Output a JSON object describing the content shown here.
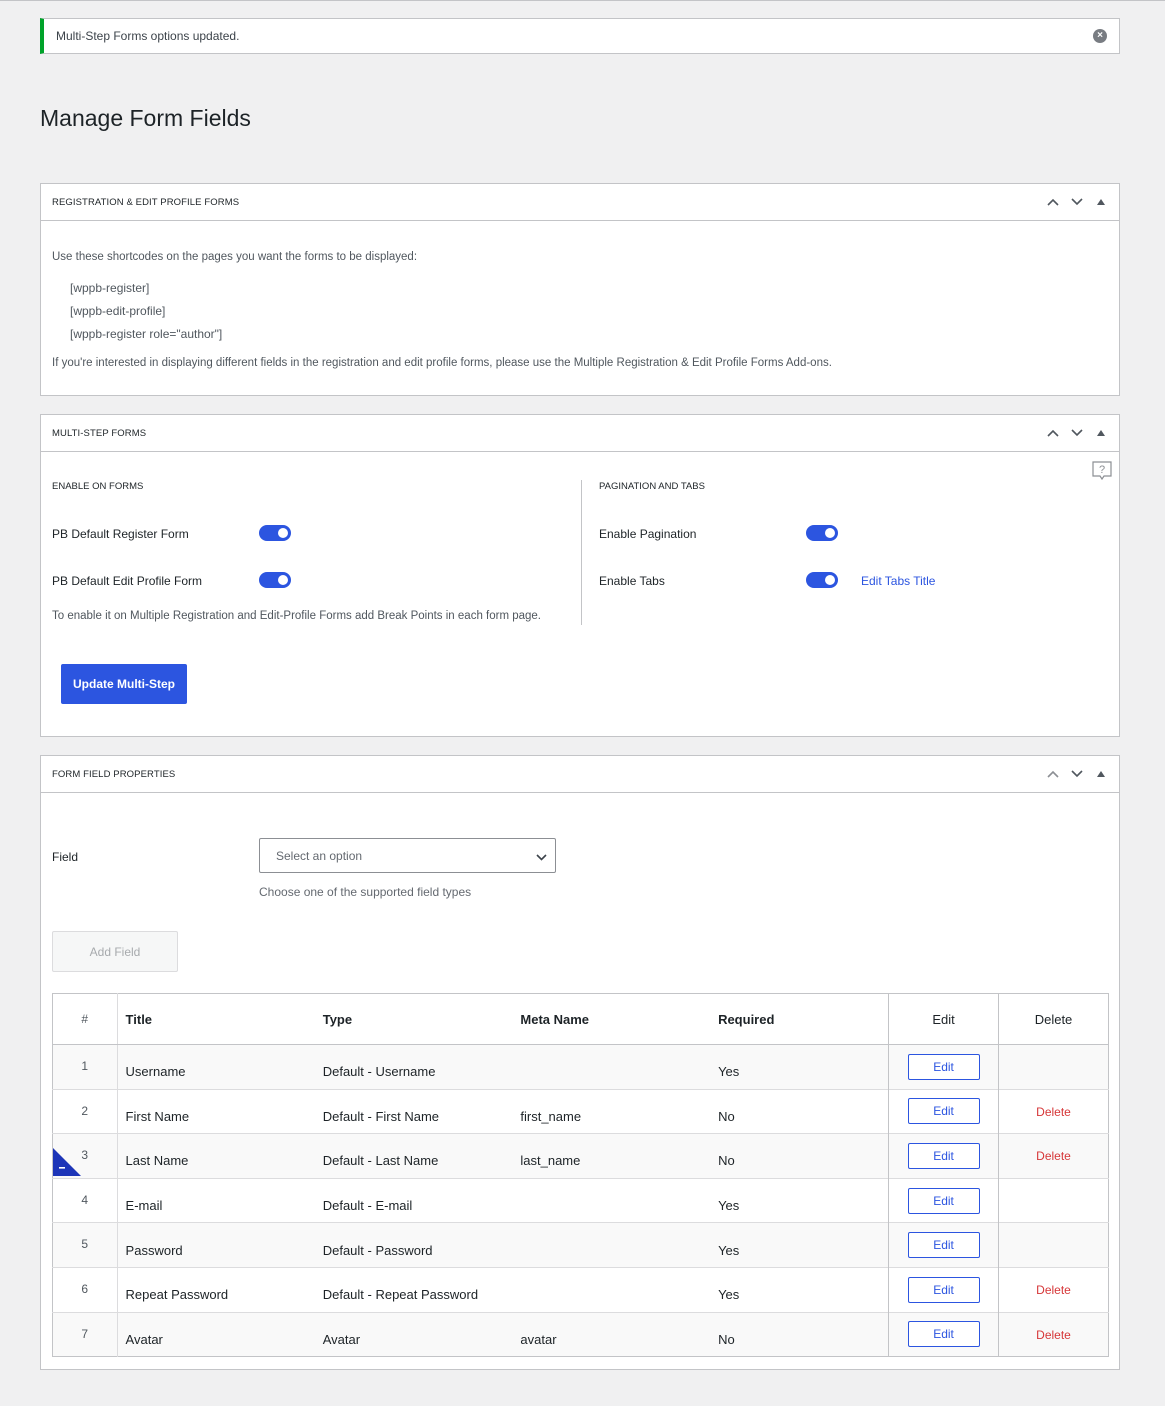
{
  "notice": {
    "message": "Multi-Step Forms options updated."
  },
  "page": {
    "title": "Manage Form Fields"
  },
  "box1": {
    "title": "REGISTRATION & EDIT PROFILE FORMS",
    "intro": "Use these shortcodes on the pages you want the forms to be displayed:",
    "shortcodes": [
      "[wppb-register]",
      "[wppb-edit-profile]",
      "[wppb-register role=\"author\"]"
    ],
    "footer": "If you're interested in displaying different fields in the registration and edit profile forms, please use the Multiple Registration & Edit Profile Forms Add-ons."
  },
  "box2": {
    "title": "MULTI-STEP FORMS",
    "left_head": "ENABLE ON FORMS",
    "right_head": "PAGINATION AND TABS",
    "opt_register": "PB Default Register Form",
    "opt_edit": "PB Default Edit Profile Form",
    "opt_pagination": "Enable Pagination",
    "opt_tabs": "Enable Tabs",
    "edit_tabs_link": "Edit Tabs Title",
    "note": "To enable it on Multiple Registration and Edit-Profile Forms add Break Points in each form page.",
    "update_button": "Update Multi-Step"
  },
  "box3": {
    "title": "FORM FIELD PROPERTIES",
    "field_label": "Field",
    "select_placeholder": "Select an option",
    "select_desc": "Choose one of the supported field types",
    "add_button": "Add Field",
    "columns": {
      "num": "#",
      "title": "Title",
      "type": "Type",
      "meta": "Meta Name",
      "required": "Required",
      "edit": "Edit",
      "delete": "Delete"
    },
    "edit_label": "Edit",
    "delete_label": "Delete",
    "rows": [
      {
        "num": "1",
        "title": "Username",
        "type": "Default - Username",
        "meta": "",
        "required": "Yes",
        "delete": ""
      },
      {
        "num": "2",
        "title": "First Name",
        "type": "Default - First Name",
        "meta": "first_name",
        "required": "No",
        "delete": "Delete"
      },
      {
        "num": "3",
        "title": "Last Name",
        "type": "Default - Last Name",
        "meta": "last_name",
        "required": "No",
        "delete": "Delete"
      },
      {
        "num": "4",
        "title": "E-mail",
        "type": "Default - E-mail",
        "meta": "",
        "required": "Yes",
        "delete": ""
      },
      {
        "num": "5",
        "title": "Password",
        "type": "Default - Password",
        "meta": "",
        "required": "Yes",
        "delete": ""
      },
      {
        "num": "6",
        "title": "Repeat Password",
        "type": "Default - Repeat Password",
        "meta": "",
        "required": "Yes",
        "delete": "Delete"
      },
      {
        "num": "7",
        "title": "Avatar",
        "type": "Avatar",
        "meta": "avatar",
        "required": "No",
        "delete": "Delete"
      }
    ]
  },
  "colors": {
    "accent": "#2c55e0",
    "success": "#00a32a",
    "danger": "#d63638"
  }
}
